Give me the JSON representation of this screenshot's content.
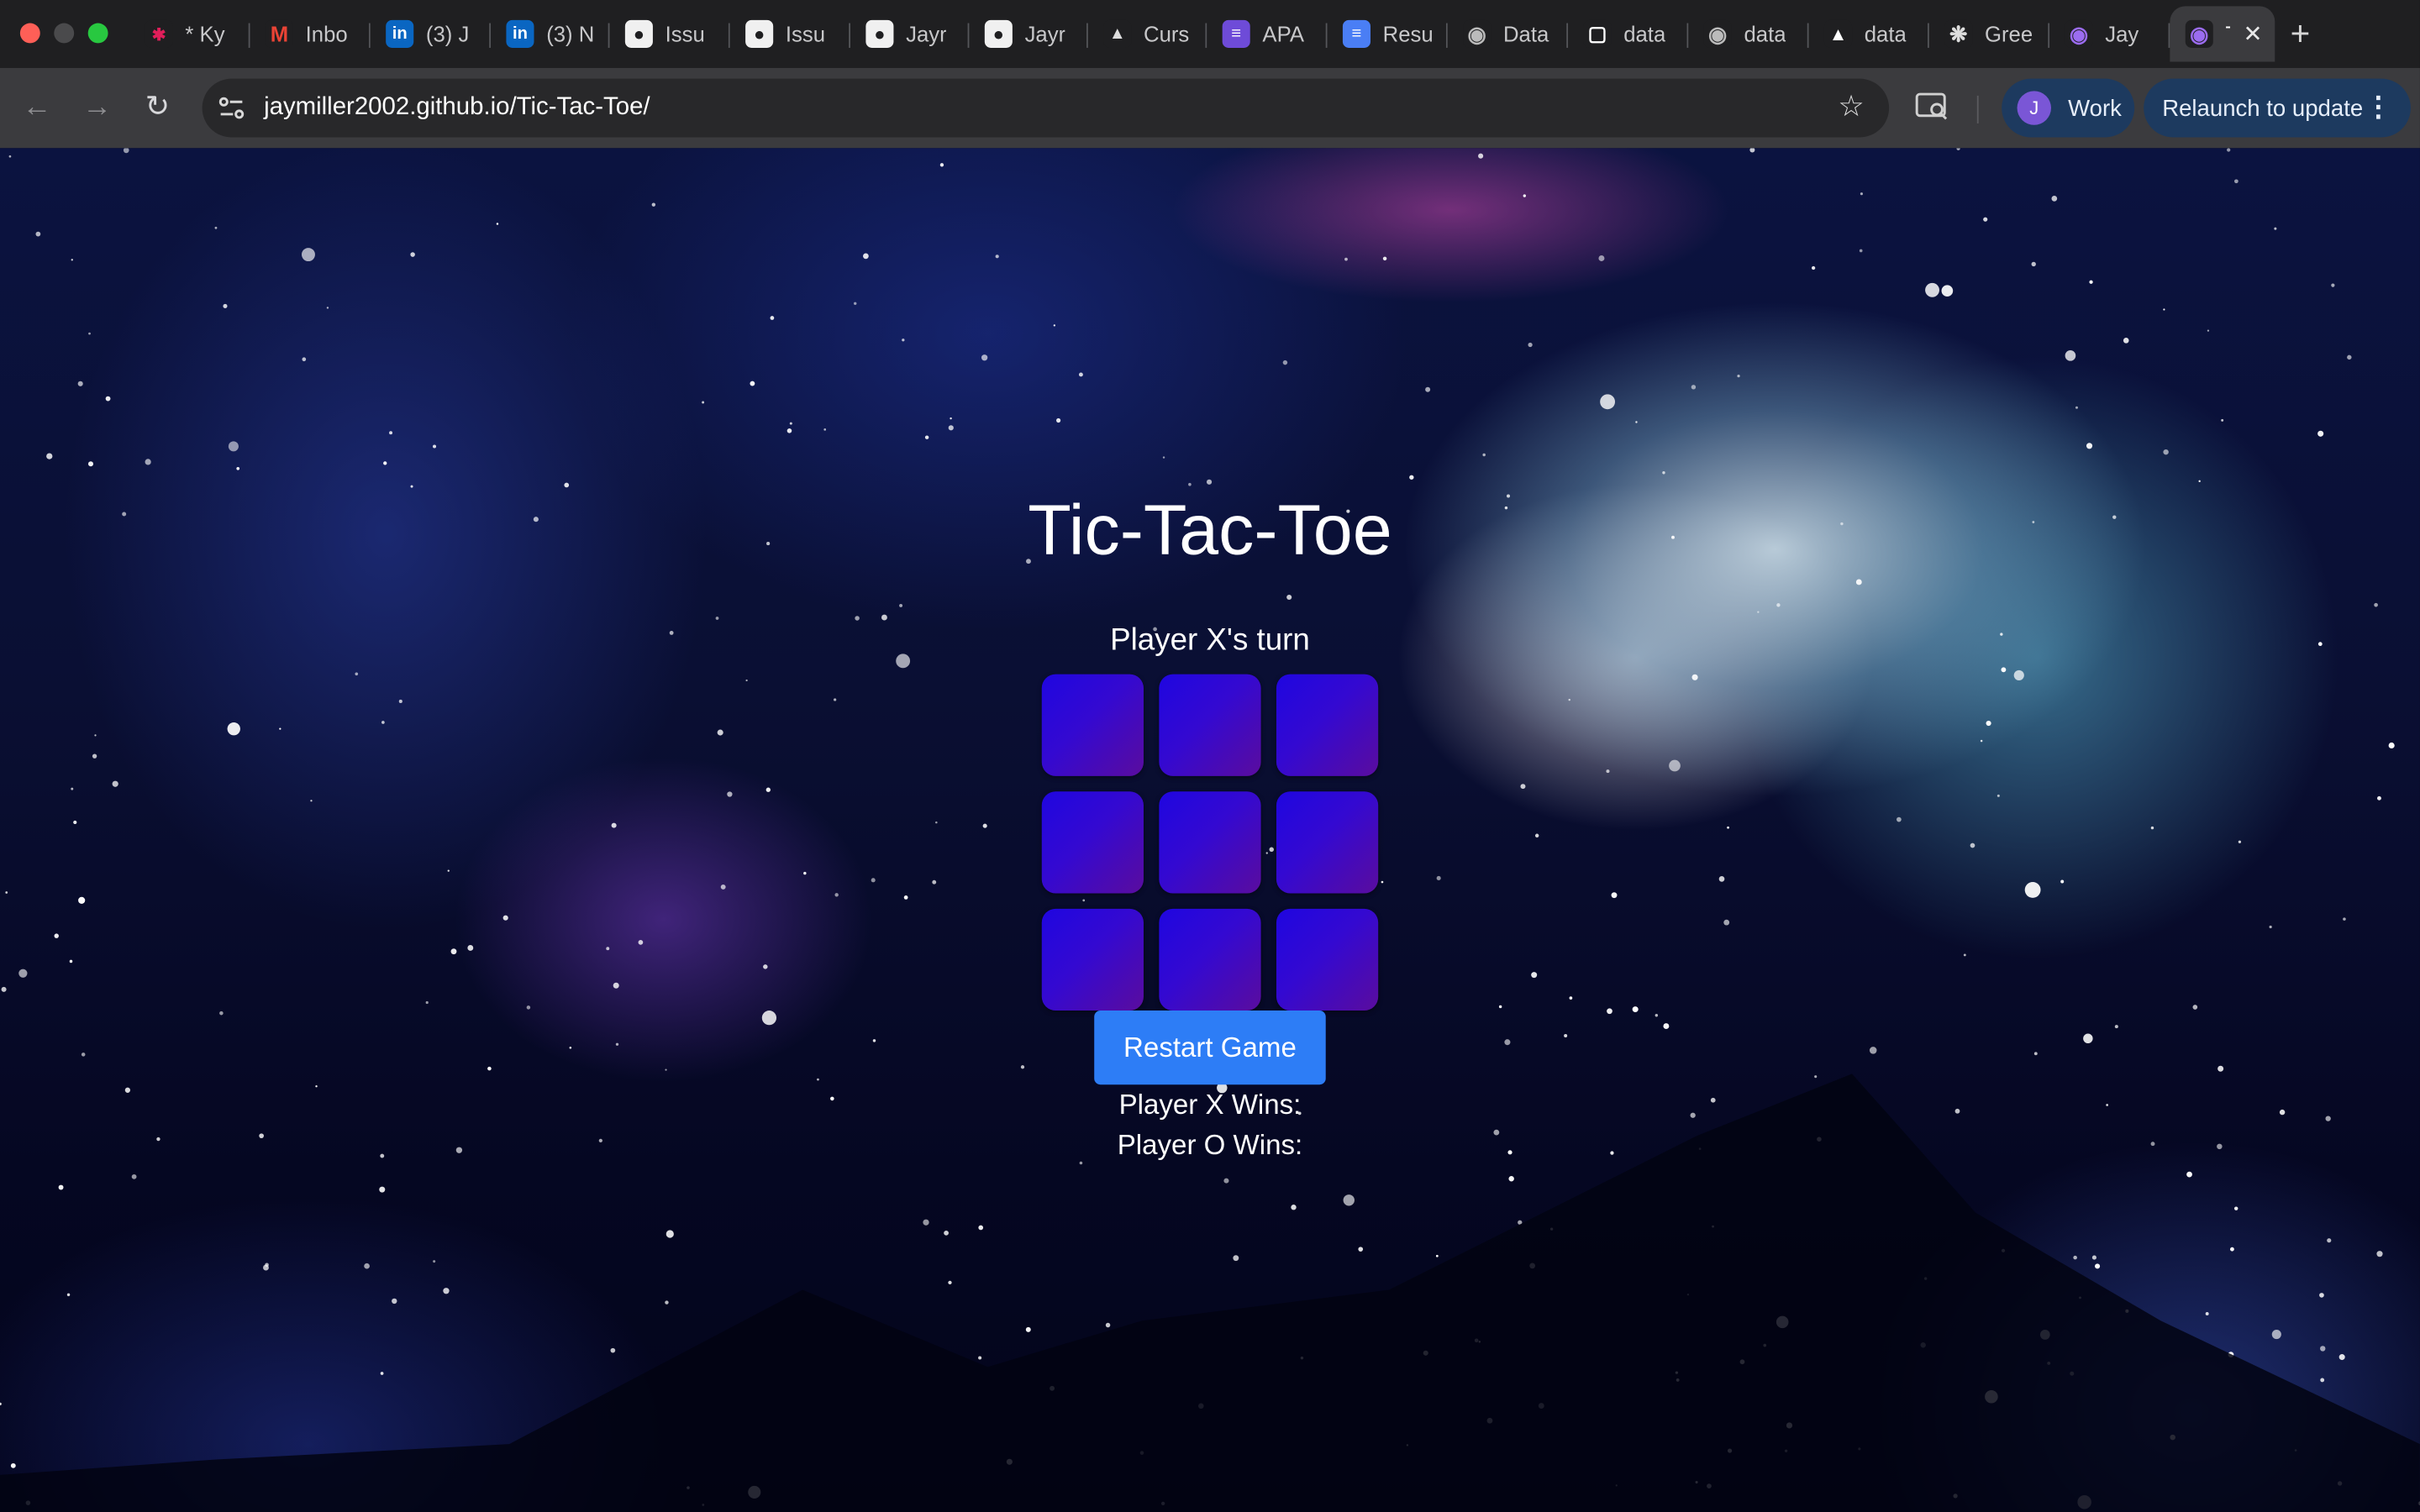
{
  "browser": {
    "tabs": [
      {
        "title": "* Ky",
        "icon": "slack-icon"
      },
      {
        "title": "Inbo",
        "icon": "gmail-icon"
      },
      {
        "title": "(3) J",
        "icon": "linkedin-icon"
      },
      {
        "title": "(3) N",
        "icon": "linkedin-icon"
      },
      {
        "title": "Issu",
        "icon": "github-icon"
      },
      {
        "title": "Issu",
        "icon": "github-icon"
      },
      {
        "title": "Jayr",
        "icon": "github-icon"
      },
      {
        "title": "Jayr",
        "icon": "github-icon"
      },
      {
        "title": "Curs",
        "icon": "cursor-icon"
      },
      {
        "title": "APA",
        "icon": "list-icon"
      },
      {
        "title": "Resu",
        "icon": "docs-icon"
      },
      {
        "title": "Data",
        "icon": "globe-icon"
      },
      {
        "title": "data",
        "icon": "app-icon"
      },
      {
        "title": "data",
        "icon": "globe-icon"
      },
      {
        "title": "data",
        "icon": "triangle-icon"
      },
      {
        "title": "Gree",
        "icon": "openai-icon"
      },
      {
        "title": "Jay",
        "icon": "alien-icon"
      },
      {
        "title": "T",
        "icon": "alien-icon",
        "active": true
      }
    ],
    "new_tab_label": "+",
    "url": "jaymiller2002.github.io/Tic-Tac-Toe/",
    "profile": {
      "initial": "J",
      "label": "Work"
    },
    "relaunch_label": "Relaunch to update"
  },
  "game": {
    "title": "Tic-Tac-Toe",
    "status": "Player X's turn",
    "board": [
      "",
      "",
      "",
      "",
      "",
      "",
      "",
      "",
      ""
    ],
    "restart_label": "Restart Game",
    "score_x_label": "Player X Wins:",
    "score_o_label": "Player O Wins:"
  },
  "colors": {
    "cell_gradient_start": "#1f06e0",
    "cell_gradient_end": "#5a0c9e",
    "restart_button": "#2d7df6",
    "browser_chrome": "#3b3b3e"
  }
}
